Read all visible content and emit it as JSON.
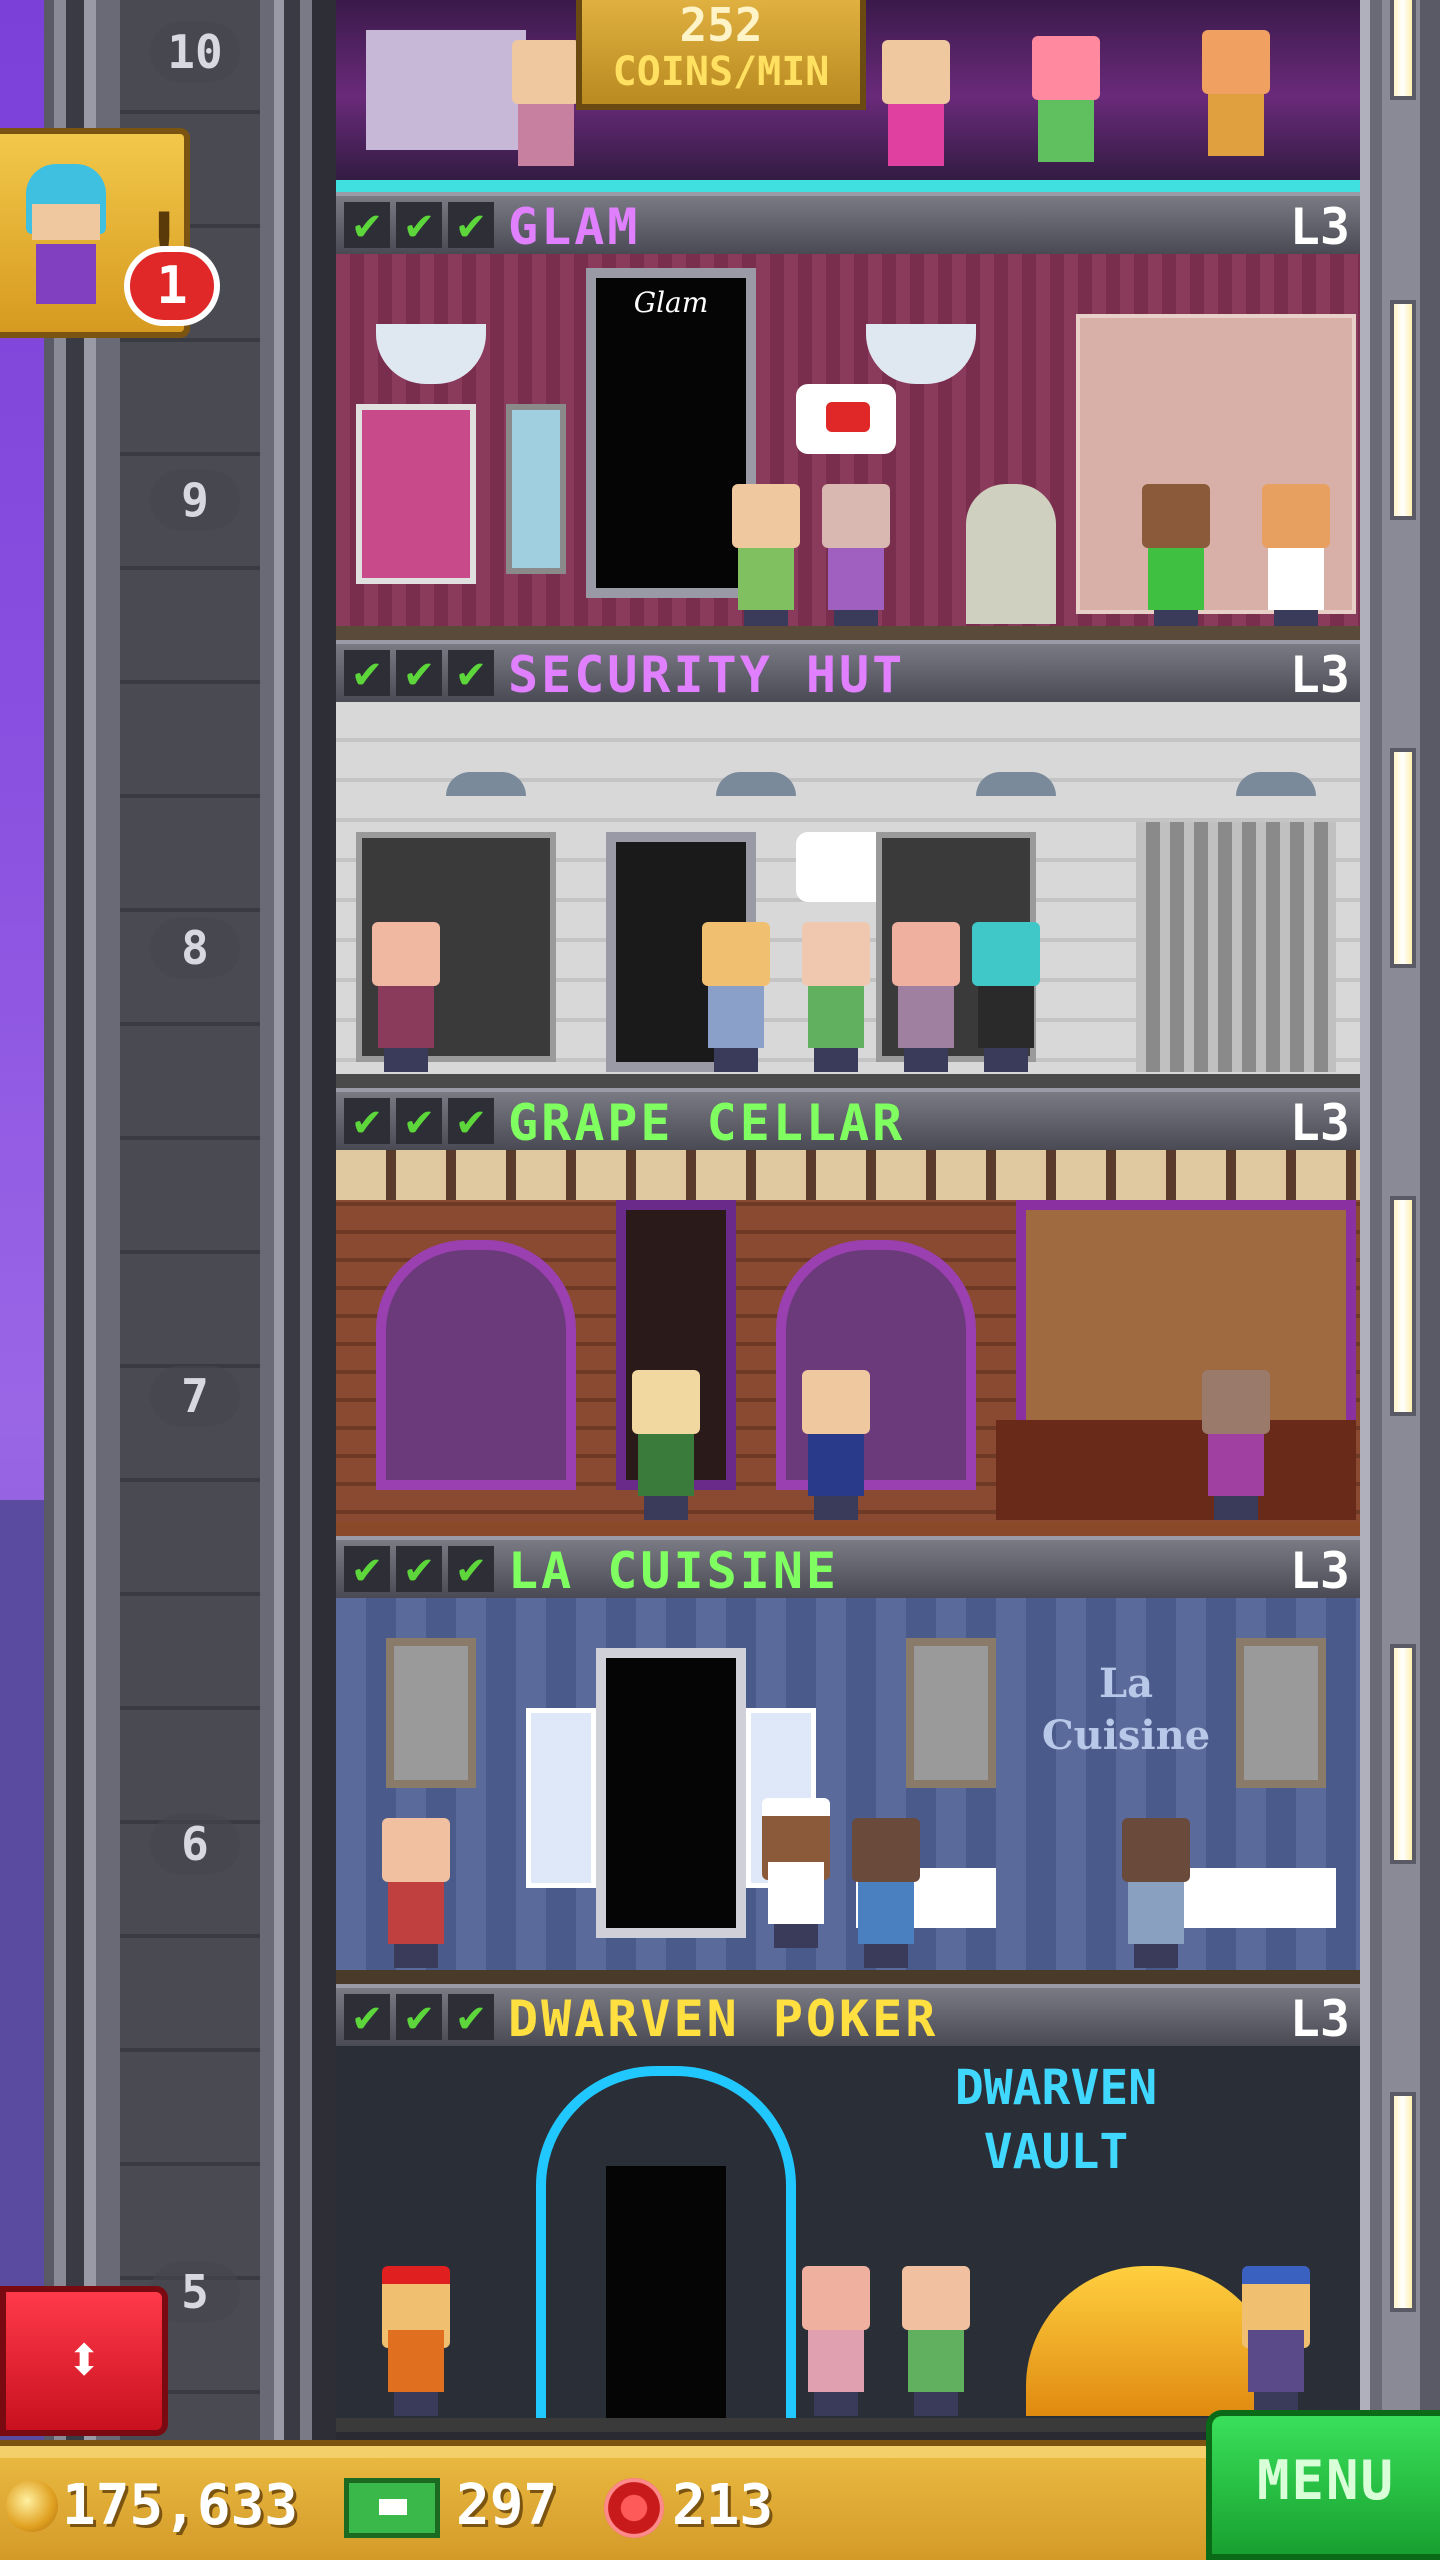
{
  "top_floor": {
    "coins_per_min_value": "252",
    "coins_per_min_unit": "COINS/MIN",
    "floor_number": "10"
  },
  "notification": {
    "badge_count": "1",
    "exclaim": "!"
  },
  "floors": [
    {
      "number": "9",
      "title": "GLAM",
      "level": "L3",
      "title_color": "#e080ff",
      "checks": "✔"
    },
    {
      "number": "8",
      "title": "SECURITY HUT",
      "level": "L3",
      "title_color": "#e080ff",
      "checks": "✔"
    },
    {
      "number": "7",
      "title": "GRAPE CELLAR",
      "level": "L3",
      "title_color": "#80ff60",
      "checks": "✔"
    },
    {
      "number": "6",
      "title": "LA CUISINE",
      "level": "L3",
      "title_color": "#80ff60",
      "checks": "✔"
    },
    {
      "number": "5",
      "title": "DWARVEN POKER",
      "level": "L3",
      "title_color": "#ffe040",
      "checks": "✔"
    }
  ],
  "signs": {
    "glam_door": "Glam",
    "cuisine_sign": "La Cuisine",
    "dwarven_vault": "DWARVEN VAULT"
  },
  "elevator_button": {
    "icon": "up-down-arrows-icon",
    "glyph": "⬍"
  },
  "bottom_bar": {
    "coins": "175,633",
    "bux": "297",
    "chips": "213",
    "menu_label": "MENU"
  },
  "colors": {
    "menu_green": "#18a030",
    "elevator_red": "#e01a28",
    "gold_bar": "#e8b840"
  }
}
